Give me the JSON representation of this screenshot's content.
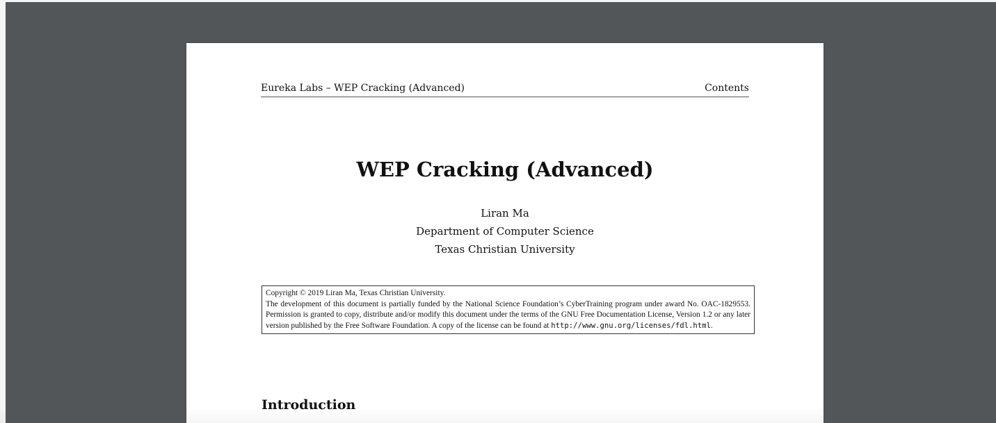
{
  "header": {
    "left_text": "Eureka Labs – WEP Cracking (Advanced)",
    "right_text": "Contents"
  },
  "document": {
    "title": "WEP Cracking (Advanced)",
    "author": "Liran Ma",
    "department": "Department of Computer Science",
    "university": "Texas Christian University"
  },
  "copyright": {
    "line1": "Copyright © 2019  Liran Ma, Texas Christian University.",
    "body": "The development of this document is partially funded by the National Science Foundation’s CyberTraining program under award No.  OAC-1829553.  Permission is granted to copy, distribute and/or modify this document under the terms of the GNU Free Documentation License, Version 1.2 or any later version published by the Free Software Foundation.  A copy of the license can be found at ",
    "url": "http://www.gnu.org/licenses/fdl.html",
    "end": "."
  },
  "section": {
    "heading": "Introduction"
  },
  "colors": {
    "viewer_background": "#525659",
    "page_background": "#ffffff"
  }
}
